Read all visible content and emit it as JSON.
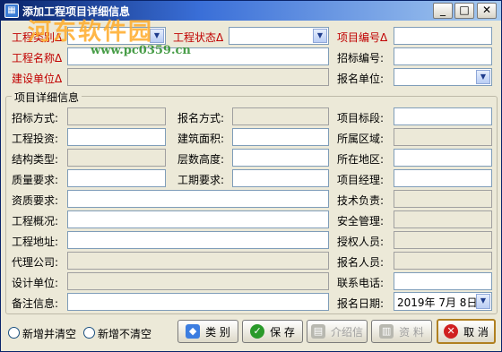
{
  "window": {
    "title": "添加工程项目详细信息",
    "min": "_",
    "max": "□",
    "close": "✕"
  },
  "watermark": {
    "text": "河东软件园",
    "url": "www.pc0359.cn"
  },
  "top": {
    "category_label": "工程类别Δ",
    "status_label": "工程状态Δ",
    "project_no_label": "项目编号Δ",
    "name_label": "工程名称Δ",
    "bid_no_label": "招标编号:",
    "builder_label": "建设单位Δ",
    "signup_unit_label": "报名单位:"
  },
  "group": {
    "title": "项目详细信息",
    "tender_method": "招标方式:",
    "signup_method": "报名方式:",
    "section": "项目标段:",
    "investment": "工程投资:",
    "area": "建筑面积:",
    "region": "所属区域:",
    "structure": "结构类型:",
    "floor_height": "层数高度:",
    "location": "所在地区:",
    "quality": "质量要求:",
    "duration": "工期要求:",
    "manager": "项目经理:",
    "qualification": "资质要求:",
    "tech_lead": "技术负责:",
    "overview": "工程概况:",
    "safety": "安全管理:",
    "address": "工程地址:",
    "authorized": "授权人员:",
    "agent": "代理公司:",
    "applicant": "报名人员:",
    "designer": "设计单位:",
    "phone": "联系电话:",
    "remarks": "备注信息:",
    "signup_date": "报名日期:",
    "signup_date_value": "2019年 7月 8日"
  },
  "bottom": {
    "radio_add_clear": "新增并清空",
    "radio_add_keep": "新增不清空",
    "btn_category": "类 别",
    "btn_save": "保 存",
    "btn_intro": "介绍信",
    "btn_material": "资 料",
    "btn_cancel": "取 消"
  }
}
